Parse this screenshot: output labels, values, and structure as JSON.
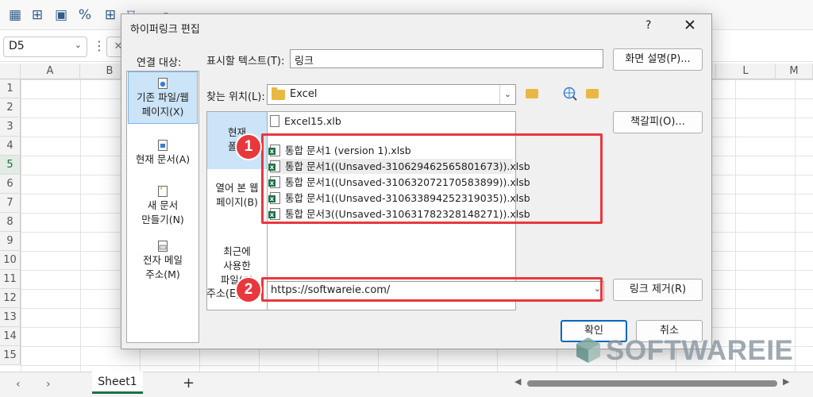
{
  "excel": {
    "name_box": "D5",
    "columns": [
      "A",
      "B",
      "L",
      "M"
    ],
    "rows": [
      "1",
      "2",
      "3",
      "4",
      "5",
      "6",
      "7",
      "8",
      "9",
      "10",
      "11",
      "12",
      "13",
      "14",
      "15"
    ],
    "selected_row": "5",
    "sheet_tab": "Sheet1",
    "add_sheet": "+"
  },
  "dialog": {
    "title": "하이퍼링크 편집",
    "help": "?",
    "close": "✕",
    "link_to_label": "연결 대상:",
    "link_to_items": [
      {
        "line1": "기존 파일/웹",
        "line2": "페이지(X)"
      },
      {
        "line1": "현재 문서(A)",
        "line2": ""
      },
      {
        "line1": "새 문서",
        "line2": "만들기(N)"
      },
      {
        "line1": "전자 메일",
        "line2": "주소(M)"
      }
    ],
    "display_text_label": "표시할 텍스트(T):",
    "display_text_value": "링크",
    "screentip_button": "화면 설명(P)...",
    "look_in_label": "찾는 위치(L):",
    "look_in_value": "Excel",
    "nav_items": [
      {
        "line1": "현재",
        "line2": "폴더"
      },
      {
        "line1": "열어 본 웹",
        "line2": "페이지(B)"
      },
      {
        "line1": "최근에",
        "line2": "사용한",
        "line3": "파일(C)"
      }
    ],
    "files": [
      "Excel15.xlb",
      "통합 문서1 (version 1).xlsb",
      "통합 문서1((Unsaved-310629462565801673)).xlsb",
      "통합 문서1((Unsaved-310632072170583899)).xlsb",
      "통합 문서1((Unsaved-310633894252319035)).xlsb",
      "통합 문서3((Unsaved-310631782328148271)).xlsb"
    ],
    "bookmark_button": "책갈피(O)...",
    "address_label": "주소(E):",
    "address_value": "https://softwareie.com/",
    "remove_link_button": "링크 제거(R)",
    "ok_button": "확인",
    "cancel_button": "취소"
  },
  "annotations": {
    "badge1": "1",
    "badge2": "2"
  },
  "watermark": "SOFTWAREIE",
  "colors": {
    "annotation_red": "#e8383d",
    "selection_blue": "#cce4f7",
    "excel_green": "#1e7145",
    "primary_border": "#0067c0"
  }
}
